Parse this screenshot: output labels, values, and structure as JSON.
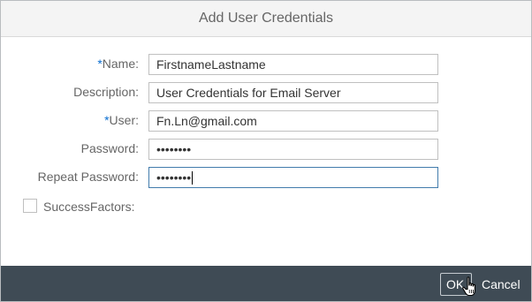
{
  "dialog": {
    "title": "Add User Credentials"
  },
  "form": {
    "name": {
      "required_mark": "*",
      "label": "Name:",
      "value": "FirstnameLastname"
    },
    "description": {
      "label": "Description:",
      "value": "User Credentials for Email Server"
    },
    "user": {
      "required_mark": "*",
      "label": "User:",
      "value": "Fn.Ln@gmail.com"
    },
    "password": {
      "label": "Password:",
      "value": "••••••••"
    },
    "repeat_password": {
      "label": "Repeat Password:",
      "value": "••••••••"
    },
    "success_factors": {
      "label": "SuccessFactors:",
      "checked": false
    }
  },
  "footer": {
    "ok_label": "OK",
    "cancel_label": "Cancel"
  },
  "colors": {
    "footer_bg": "#3f4b55",
    "required_mark": "#0a6ed1",
    "focus_border": "#427cac"
  },
  "icons": {
    "cursor": "hand-pointer-icon"
  }
}
